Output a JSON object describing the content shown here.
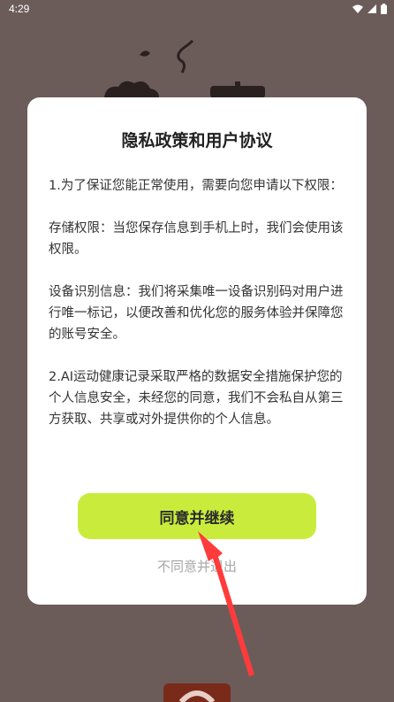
{
  "status_bar": {
    "time": "4:29",
    "icons": [
      "wifi-icon",
      "signal-icon",
      "battery-icon"
    ]
  },
  "dialog": {
    "title": "隐私政策和用户协议",
    "paragraphs": [
      "1.为了保证您能正常使用，需要向您申请以下权限：",
      "存储权限：当您保存信息到手机上时，我们会使用该权限。",
      "设备识别信息：我们将采集唯一设备识别码对用户进行唯一标记，以便改善和优化您的服务体验并保障您的账号安全。",
      "2.AI运动健康记录采取严格的数据安全措施保护您的个人信息安全，未经您的同意，我们不会私自从第三方获取、共享或对外提供你的个人信息。"
    ],
    "agree_label": "同意并继续",
    "decline_label": "不同意并退出"
  },
  "colors": {
    "background": "#6b5c5a",
    "accent": "#c9ec3c",
    "arrow": "#ff3b3b"
  }
}
